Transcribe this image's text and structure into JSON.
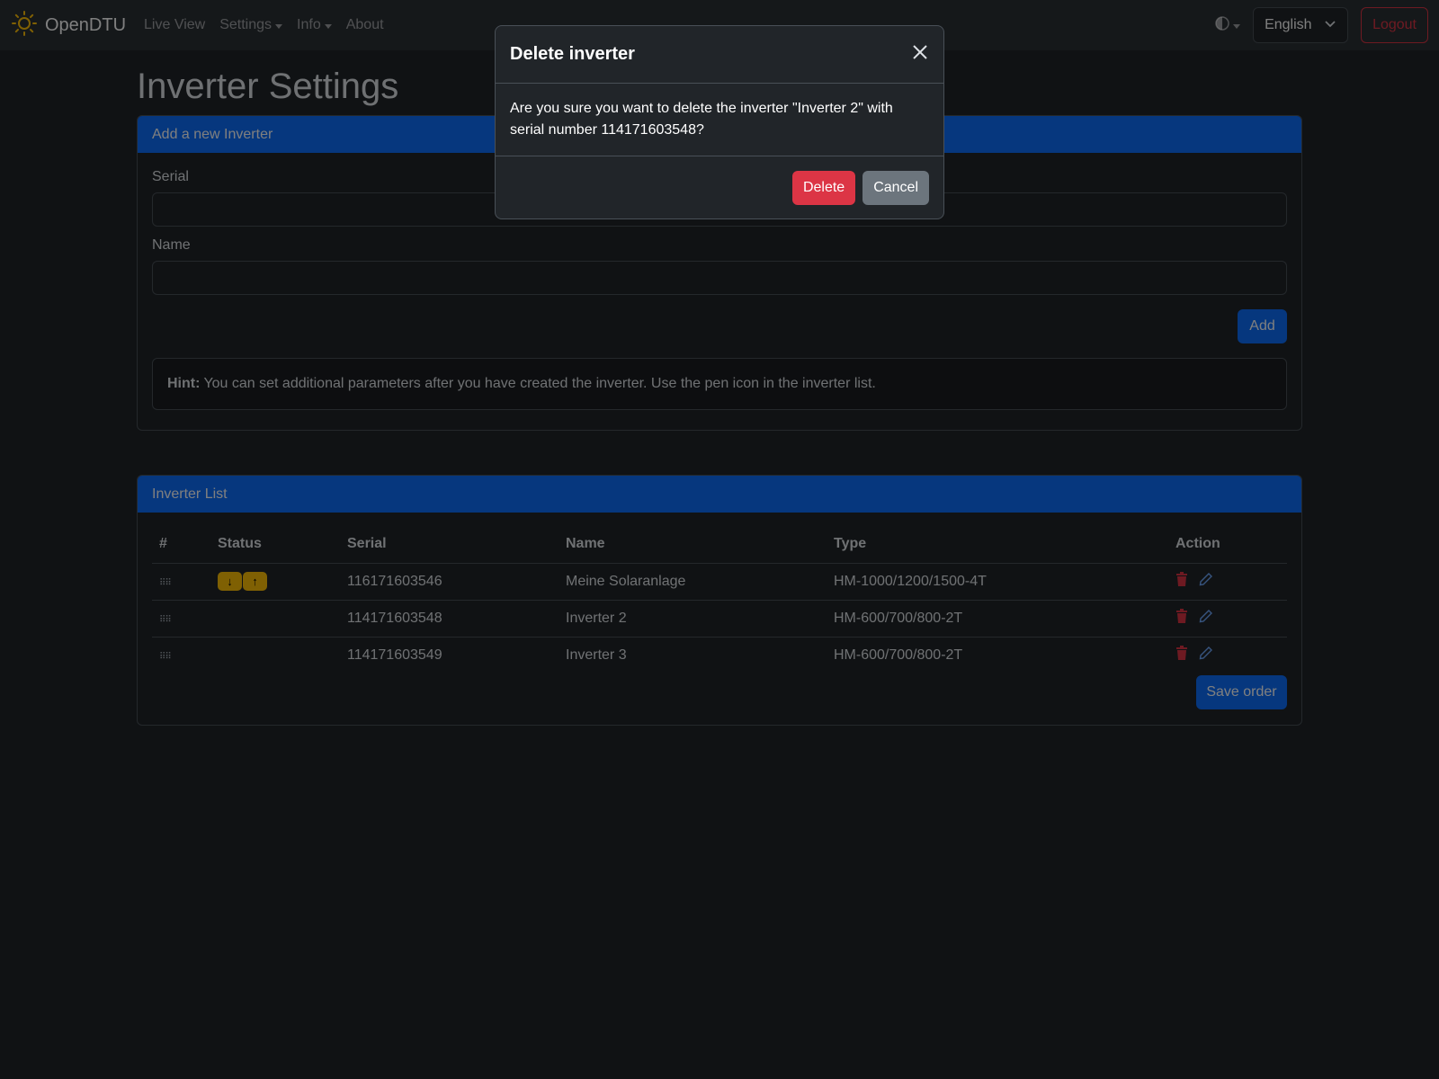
{
  "navbar": {
    "brand": "OpenDTU",
    "links": [
      {
        "label": "Live View"
      },
      {
        "label": "Settings"
      },
      {
        "label": "Info"
      },
      {
        "label": "About"
      }
    ],
    "language": "English",
    "logout": "Logout"
  },
  "page": {
    "title": "Inverter Settings"
  },
  "add_card": {
    "header": "Add a new Inverter",
    "serial_label": "Serial",
    "name_label": "Name",
    "add_button": "Add",
    "hint_bold": "Hint:",
    "hint_text": "You can set additional parameters after you have created the inverter. Use the pen icon in the inverter list."
  },
  "list_card": {
    "header": "Inverter List",
    "columns": [
      "#",
      "Status",
      "Serial",
      "Name",
      "Type",
      "Action"
    ],
    "rows": [
      {
        "serial": "116171603546",
        "name": "Meine Solaranlage",
        "type": "HM-1000/1200/1500-4T"
      },
      {
        "serial": "114171603548",
        "name": "Inverter 2",
        "type": "HM-600/700/800-2T"
      },
      {
        "serial": "114171603549",
        "name": "Inverter 3",
        "type": "HM-600/700/800-2T"
      }
    ],
    "save_order": "Save order"
  },
  "modal": {
    "title": "Delete inverter",
    "message": "Are you sure you want to delete the inverter \"Inverter 2\" with serial number 114171603548?",
    "delete": "Delete",
    "cancel": "Cancel"
  },
  "colors": {
    "primary": "#0d6efd",
    "danger": "#dc3545",
    "warning": "#ffc107",
    "secondary": "#6c757d"
  },
  "icons": [
    "sun-logo-icon",
    "theme-toggle-icon",
    "chevron-down-icon",
    "close-icon",
    "drag-handle-icon",
    "arrow-down-icon",
    "arrow-up-icon",
    "trash-icon",
    "pencil-icon"
  ]
}
